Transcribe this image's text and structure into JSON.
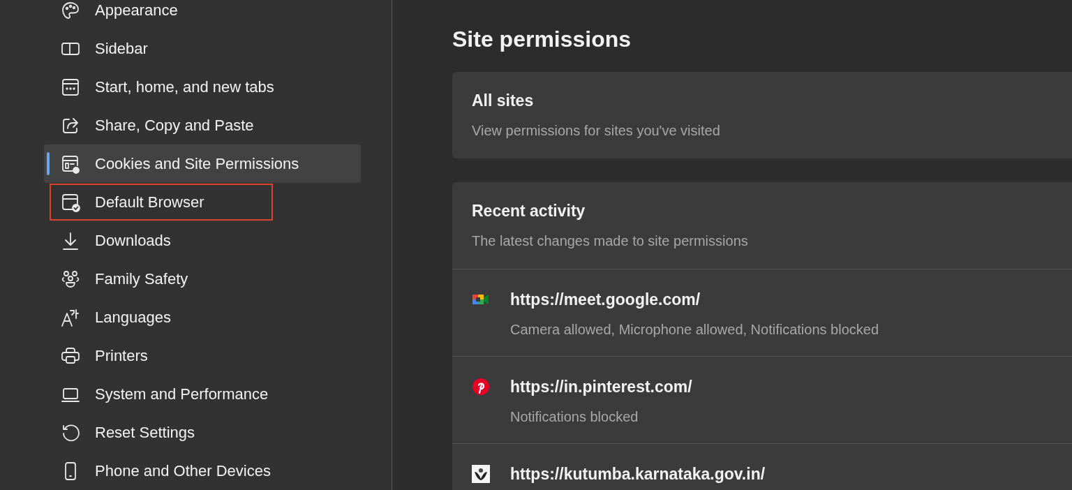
{
  "sidebar": {
    "items": [
      {
        "label": "Appearance",
        "selected": false,
        "highlighted": false
      },
      {
        "label": "Sidebar",
        "selected": false,
        "highlighted": false
      },
      {
        "label": "Start, home, and new tabs",
        "selected": false,
        "highlighted": false
      },
      {
        "label": "Share, Copy and Paste",
        "selected": false,
        "highlighted": false
      },
      {
        "label": "Cookies and Site Permissions",
        "selected": true,
        "highlighted": false
      },
      {
        "label": "Default Browser",
        "selected": false,
        "highlighted": true
      },
      {
        "label": "Downloads",
        "selected": false,
        "highlighted": false
      },
      {
        "label": "Family Safety",
        "selected": false,
        "highlighted": false
      },
      {
        "label": "Languages",
        "selected": false,
        "highlighted": false
      },
      {
        "label": "Printers",
        "selected": false,
        "highlighted": false
      },
      {
        "label": "System and Performance",
        "selected": false,
        "highlighted": false
      },
      {
        "label": "Reset Settings",
        "selected": false,
        "highlighted": false
      },
      {
        "label": "Phone and Other Devices",
        "selected": false,
        "highlighted": false
      }
    ]
  },
  "page_title": "Site permissions",
  "all_sites": {
    "title": "All sites",
    "description": "View permissions for sites you've visited"
  },
  "recent_activity": {
    "title": "Recent activity",
    "description": "The latest changes made to site permissions",
    "sites": [
      {
        "url": "https://meet.google.com/",
        "details": "Camera allowed, Microphone allowed, Notifications blocked"
      },
      {
        "url": "https://in.pinterest.com/",
        "details": "Notifications blocked"
      },
      {
        "url": "https://kutumba.karnataka.gov.in/"
      }
    ]
  }
}
